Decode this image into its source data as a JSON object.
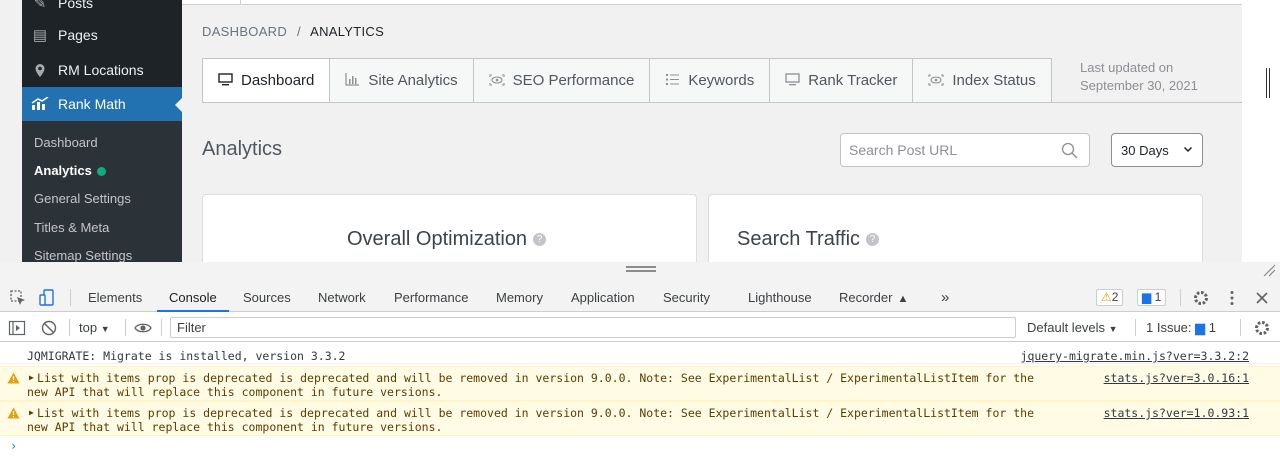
{
  "sidebar": {
    "items": [
      {
        "label": "Posts",
        "icon": "pin-icon"
      },
      {
        "label": "Pages",
        "icon": "pages-icon"
      },
      {
        "label": "RM Locations",
        "icon": "location-pin-icon"
      },
      {
        "label": "Rank Math",
        "icon": "rank-math-icon"
      }
    ],
    "submenu": [
      {
        "label": "Dashboard"
      },
      {
        "label": "Analytics"
      },
      {
        "label": "General Settings"
      },
      {
        "label": "Titles & Meta"
      },
      {
        "label": "Sitemap Settings"
      }
    ]
  },
  "breadcrumb": {
    "parent": "DASHBOARD",
    "separator": "/",
    "current": "ANALYTICS"
  },
  "tabs": [
    {
      "label": "Dashboard"
    },
    {
      "label": "Site Analytics"
    },
    {
      "label": "SEO Performance"
    },
    {
      "label": "Keywords"
    },
    {
      "label": "Rank Tracker"
    },
    {
      "label": "Index Status"
    }
  ],
  "last_updated": {
    "line1": "Last updated on",
    "line2": "September 30, 2021"
  },
  "analytics": {
    "title": "Analytics",
    "search_placeholder": "Search Post URL",
    "range": "30 Days"
  },
  "cards": [
    {
      "title": "Overall Optimization",
      "help": "?"
    },
    {
      "title": "Search Traffic",
      "help": "?"
    }
  ],
  "devtools": {
    "tabs": [
      "Elements",
      "Console",
      "Sources",
      "Network",
      "Performance",
      "Memory",
      "Application",
      "Security",
      "Lighthouse",
      "Recorder"
    ],
    "active_tab": "Console",
    "more": "»",
    "warnings_count": "2",
    "messages_count": "1",
    "console_toolbar": {
      "context": "top",
      "filter_placeholder": "Filter",
      "levels": "Default levels",
      "issues_label": "1 Issue:",
      "issues_count": "1"
    },
    "messages": [
      {
        "level": "info",
        "text": "JQMIGRATE: Migrate is installed, version 3.3.2",
        "source": "jquery-migrate.min.js?ver=3.3.2:2"
      },
      {
        "level": "warning",
        "text": "List with items prop is deprecated is deprecated and will be removed in version 9.0.0. Note: See ExperimentalList / ExperimentalListItem for the\nnew API that will replace this component in future versions.",
        "source": "stats.js?ver=3.0.16:1"
      },
      {
        "level": "warning",
        "text": "List with items prop is deprecated is deprecated and will be removed in version 9.0.0. Note: See ExperimentalList / ExperimentalListItem for the\nnew API that will replace this component in future versions.",
        "source": "stats.js?ver=1.0.93:1"
      }
    ],
    "prompt": "›"
  },
  "colors": {
    "wp_admin_dark": "#1d2327",
    "wp_accent": "#2271b1",
    "analytics_dot": "#10ac84",
    "devtools_blue": "#1a73e8",
    "warning_bg": "#fffbe5"
  }
}
